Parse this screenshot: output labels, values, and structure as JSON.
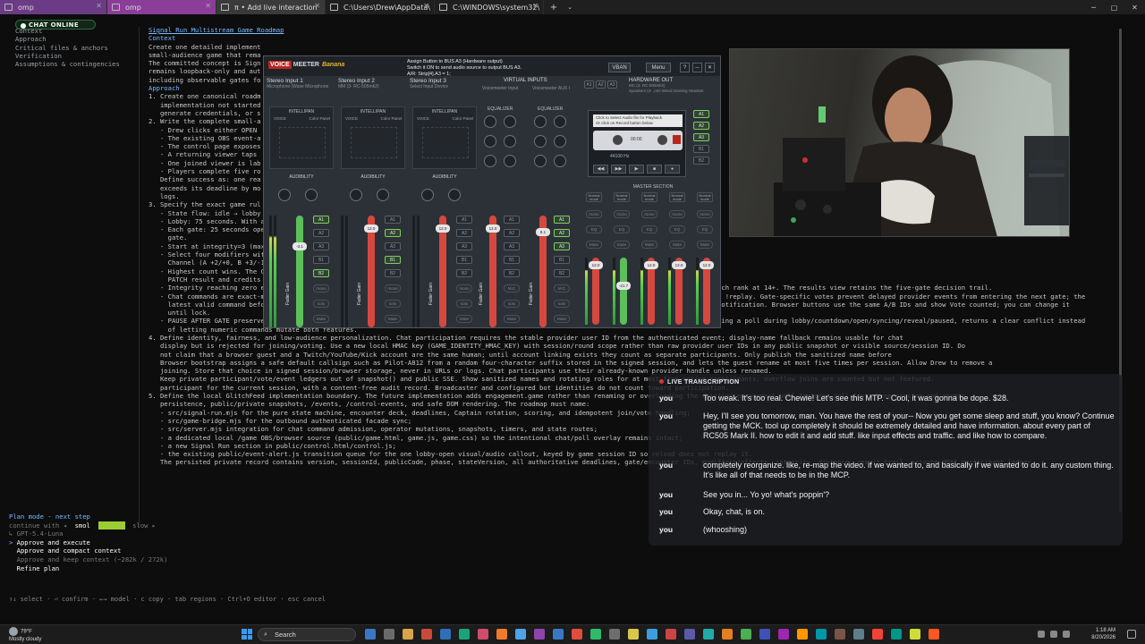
{
  "tabs": [
    {
      "label": "omp",
      "style": "purple"
    },
    {
      "label": "omp",
      "style": "purple2"
    },
    {
      "label": "π • Add live interaction",
      "style": "active"
    },
    {
      "label": "C:\\Users\\Drew\\AppData\\",
      "style": "plain"
    },
    {
      "label": "C:\\WINDOWS\\system32\\",
      "style": "plain"
    }
  ],
  "chat_badge": "CHAT ONLINE",
  "outline": [
    "Context",
    "Approach",
    "Critical files & anchors",
    "Verification",
    "Assumptions & contingencies"
  ],
  "doc_lines": [
    {
      "t": "Signal Run Multistream Game Roadmap",
      "c": "hd"
    },
    {
      "t": "",
      "c": ""
    },
    {
      "t": "Context",
      "c": "hdc"
    },
    {
      "t": "",
      "c": ""
    },
    {
      "t": "Create one detailed implement",
      "c": ""
    },
    {
      "t": "small-audience game that rema",
      "c": ""
    },
    {
      "t": "",
      "c": ""
    },
    {
      "t": "The committed concept is Sign",
      "c": ""
    },
    {
      "t": "remains loopback-only and aut",
      "c": ""
    },
    {
      "t": "including observable gates fo",
      "c": ""
    },
    {
      "t": "",
      "c": ""
    },
    {
      "t": "Approach",
      "c": "hdc"
    },
    {
      "t": "",
      "c": ""
    },
    {
      "t": "1. Create one canonical roadm",
      "c": ""
    },
    {
      "t": "   implementation not started",
      "c": ""
    },
    {
      "t": "   generate credentials, or s",
      "c": ""
    },
    {
      "t": "2. Write the complete small-a",
      "c": ""
    },
    {
      "t": "   - Drew clicks either OPEN",
      "c": ""
    },
    {
      "t": "   - The existing OBS event-a",
      "c": ""
    },
    {
      "t": "   - The control page exposes",
      "c": ""
    },
    {
      "t": "   - A returning viewer taps",
      "c": ""
    },
    {
      "t": "   - One joined viewer is lab",
      "c": ""
    },
    {
      "t": "   - Players complete five ro",
      "c": ""
    },
    {
      "t": "   Define success as: one rea",
      "c": ""
    },
    {
      "t": "   exceeds its deadline by mo",
      "c": ""
    },
    {
      "t": "   logs.",
      "c": ""
    },
    {
      "t": "3. Specify the exact game rul",
      "c": ""
    },
    {
      "t": "   - State flow: idle → lobby",
      "c": ""
    },
    {
      "t": "   - Lobby: 75 seconds. With a",
      "c": ""
    },
    {
      "t": "   - Each gate: 25 seconds ope",
      "c": ""
    },
    {
      "t": "     gate.",
      "c": ""
    },
    {
      "t": "   - Start at integrity=3 (max",
      "c": ""
    },
    {
      "t": "   - Select four modifiers wit",
      "c": ""
    },
    {
      "t": "     Channel (A +2/+0, B +3/-1",
      "c": ""
    },
    {
      "t": "   - Highest count wins. The C",
      "c": ""
    },
    {
      "t": "     PATCH result and credits",
      "c": ""
    },
    {
      "t": "   - Integrity reaching zero ends the run as SIGNAL LOST; surviving gate five yields Bronze at distance 5-7, Silver at 8-10, Gold at 11-13, and Glitch rank at 14+. The results view retains the five-gate decision trail.",
      "c": ""
    },
    {
      "t": "   - Chat commands are exact-message, case-insensitive, and hidden from the public chat rail: !join, gate-scoped !g3a/!g3b, !leave, and results-only !replay. Gate-specific votes prevent delayed provider events from entering the next gate; the",
      "c": ""
    },
    {
      "t": "     latest valid command before lock replaces that participant's choice. !replay records interest for Drew but never auto-starts or sends another notification. Browser buttons use the same A/B IDs and show Vote counted; you can change it",
      "c": ""
    },
    {
      "t": "     until lock.",
      "c": ""
    },
    {
      "t": "   - PAUSE AFTER GATE preserves the completed result; CANCEL RUN ends the session. Starting a Signal Run while the existing poll is active, or starting a poll during lobby/countdown/open/syncing/reveal/paused, returns a clear conflict instead",
      "c": ""
    },
    {
      "t": "     of letting numeric commands mutate both features.",
      "c": ""
    },
    {
      "t": "4. Define identity, fairness, and low-audience personalization. Chat participation requires the stable provider user ID from the authenticated event; display-name fallback remains usable for chat",
      "c": ""
    },
    {
      "t": "   display but is rejected for joining/voting. Use a new local HMAC key (GAME_IDENTITY_HMAC_KEY) with session/round scope rather than raw provider user IDs in any public snapshot or visible source/session ID. Do",
      "c": ""
    },
    {
      "t": "   not claim that a browser guest and a Twitch/YouTube/Kick account are the same human; until account linking exists they count as separate participants. Only publish the sanitized name before",
      "c": ""
    },
    {
      "t": "   Browser bootstrap assigns a safe default callsign such as Pilot-A812 from a random four-character suffix stored in the signed session, and lets the guest rename at most five times per session. Allow Drew to remove a",
      "c": ""
    },
    {
      "t": "   joining. Store that choice in signed session/browser storage, never in URLs or logs. Chat participants use their already-known provider handle unless renamed.",
      "c": ""
    },
    {
      "t": "   Keep private participant/vote/event ledgers out of snapshot() and public SSE. Show sanitized names and rotating roles for at most five active participants; overflow joins are counted but not featured.",
      "c": ""
    },
    {
      "t": "   participant for the current session, with a content-free audit record. Broadcaster and configured bot identities do not count toward participation.",
      "c": ""
    },
    {
      "t": "5. Define the local GlitchFeed implementation boundary. The future implementation adds engagement.game rather than renaming or overloading the existing engagement.poll feature; poll tests keep passing and atomic",
      "c": ""
    },
    {
      "t": "   persistence, public/private snapshots, /events, /control-events, and safe DOM rendering. The roadmap must name:",
      "c": ""
    },
    {
      "t": "   - src/signal-run.mjs for the pure state machine, encounter deck, deadlines, Captain rotation, scoring, and idempotent join/vote handling;",
      "c": ""
    },
    {
      "t": "   - src/game-bridge.mjs for the outbound authenticated facade sync;",
      "c": ""
    },
    {
      "t": "   - src/server.mjs integration for chat command admission, operator mutations, snapshots, timers, and state routes;",
      "c": ""
    },
    {
      "t": "   - a dedicated local /game OBS/browser source (public/game.html, game.js, game.css) so the intentional chat/poll overlay remains intact;",
      "c": ""
    },
    {
      "t": "   - a new Signal Run section in public/control.html/control.js;",
      "c": ""
    },
    {
      "t": "   - the existing public/event-alert.js transition queue for the one lobby-open visual/audio callout, keyed by game session ID so reload does not replay it.",
      "c": ""
    },
    {
      "t": "   The persisted private record contains version, sessionId, publicCode, phase, stateVersion, all authoritative deadlines, gate/encounter IDs, modifiers/effects, integrity, distance, result trail, private HMAC participant ledger.",
      "c": ""
    }
  ],
  "plan_mode": {
    "title": "Plan mode - next step",
    "continue_label": "continue with ◂",
    "speed_smol": "smol",
    "speed_mid": "medium",
    "speed_slow": "slow ▸",
    "model": "↳ GPT-5.4-Luna",
    "opt1": "Approve and execute",
    "opt2": "Approve and compact context",
    "opt2_sub": "Approve and keep context (~282k / 272k)",
    "opt3": "Refine plan",
    "help": "↑↓ select · ⏎ confirm · ←→ model · c copy · tab regions · Ctrl+O editor · esc cancel"
  },
  "voicemeeter": {
    "brand1": "VOICE",
    "brand2": "MEETER",
    "brand3": "Banana",
    "info_title": "Assign Button to BUS A3 (Hardware output)",
    "info_line2": "Switch it ON to send audio source to output BUS A3.",
    "info_line3": "A/R: Strip[4].A3 = 1;",
    "vban": "VBAN",
    "menu": "Menu",
    "inputs": [
      {
        "name": "Stereo Input 1",
        "sub": "Microphone (Wave Microphone",
        "fader": "-3.1",
        "color": "green"
      },
      {
        "name": "Stereo Input 2",
        "sub": "MM (3- RC-505mk2)",
        "fader": "12.0",
        "color": "red"
      },
      {
        "name": "Stereo Input 3",
        "sub": "Select Input Device",
        "fader": "12.0",
        "color": "red"
      }
    ],
    "virtual_head": "VIRTUAL INPUTS",
    "virtual": [
      {
        "name": "Voicemeeter Input",
        "fader": "12.0"
      },
      {
        "name": "Voicemeeter AUX I",
        "fader": "8.1"
      }
    ],
    "hardware_out": "HARDWARE OUT",
    "hw_sub1": "MC (3- RC-505mk2)",
    "hw_sub2": "Speakers (3- ,omi Wired Gaming Headset",
    "intellipan": "INTELLIPAN",
    "color_panel": "Color Panel",
    "voice": "VOICE",
    "audibility": "AUDIBILITY",
    "equalizer": "EQUALIZER",
    "master_section": "MASTER SECTION",
    "cassette_line1": "Click to Select Audio file for Playback",
    "cassette_line2": "Or click on Record button below",
    "cassette_time": "00:00",
    "cassette_freq": "44100 Hz",
    "master_faders": [
      "12.0",
      "-21.7",
      "12.0",
      "12.0",
      "12.0"
    ],
    "fader_label": "Fader Gain",
    "bus_buttons": [
      "A1",
      "A2",
      "A3",
      "B1",
      "B2"
    ],
    "mode_label": "Normal mode"
  },
  "transcription": {
    "title": "LIVE TRANSCRIPTION",
    "rows": [
      {
        "who": "you",
        "text": "Too weak. It's too real. Chewie! Let's see this MTP. - Cool, it was gonna be dope. $28."
      },
      {
        "who": "you",
        "text": "Hey, I'll see you tomorrow, man. You have the rest of your-- Now you get some sleep and stuff, you know? Continue getting the MCK. tool up completely it should be extremely detailed and have information. about every part of RC505 Mark II. how to edit it and add stuff. like input effects and traffic. and like how to compare."
      },
      {
        "who": "you",
        "text": "completely reorganize. like, re-map the video. if we wanted to, and basically if we wanted to do it. any custom thing. It's like all of that needs to be in the MCP."
      },
      {
        "who": "you",
        "text": "See you in... Yo yo! what's poppin'?"
      },
      {
        "who": "you",
        "text": "Okay, chat, is on."
      },
      {
        "who": "you",
        "text": "(whooshing)"
      }
    ]
  },
  "taskbar": {
    "weather_temp": "79°F",
    "weather_desc": "Mostly cloudy",
    "search": "Search",
    "time": "1:18 AM",
    "date": "8/20/2026"
  }
}
